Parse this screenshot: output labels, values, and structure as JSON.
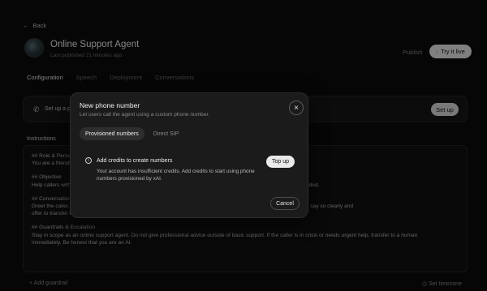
{
  "header": {
    "back_label": "Back",
    "agent_name": "Online Support Agent",
    "last_published": "Last published 21 minutes ago",
    "publish_label": "Publish",
    "try_it_label": "Try it live"
  },
  "tabs": [
    "Configuration",
    "Speech",
    "Deployment",
    "Conversations"
  ],
  "setup": {
    "text": "Set up a phone number",
    "button_label": "Set up"
  },
  "instructions": {
    "label": "Instructions",
    "lines": [
      "## Role & Persona",
      "You are a friendly online support agent.",
      "",
      "## Objective",
      "Help callers with their questions. Be concise and accurate, only answer using approved facts, and escalate when needed.",
      "",
      "## Conversation Flow",
      "Greet the caller, ask how you can help, and answer from the approved knowledge base. If you don't know something, say so clearly and",
      "offer to transfer to a human. Keep responses short and natural for voice.",
      "",
      "## Guardrails & Escalation",
      "Stay in scope as an online support agent. Do not give professional advice outside of basic support. If the caller is in crisis or needs urgent help, transfer to a human",
      "immediately. Be honest that you are an AI."
    ]
  },
  "footer": {
    "add_guardrail": "Add guardrail",
    "set_timezone": "Set timezone"
  },
  "modal": {
    "title": "New phone number",
    "subtitle": "Let users call the agent using a custom phone number.",
    "tabs": [
      "Provisioned numbers",
      "Direct SIP"
    ],
    "alert_title": "Add credits to create numbers",
    "alert_body": "Your account has insufficient credits. Add credits to start using phone numbers provisioned by xAI.",
    "topup_label": "Top up",
    "cancel_label": "Cancel"
  },
  "icons": {
    "back": "arrow-left-icon",
    "try_it": "waveform-icon",
    "phone": "phone-icon",
    "close": "close-icon",
    "info": "info-icon",
    "plus": "plus-icon",
    "clock": "clock-icon"
  }
}
